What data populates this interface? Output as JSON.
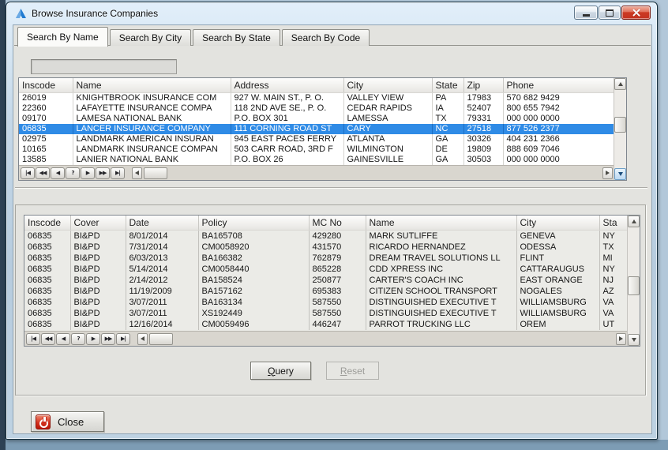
{
  "window": {
    "title": "Browse Insurance Companies"
  },
  "tabs": [
    {
      "label": "Search By Name",
      "active": true
    },
    {
      "label": "Search By City",
      "active": false
    },
    {
      "label": "Search By State",
      "active": false
    },
    {
      "label": "Search By Code",
      "active": false
    }
  ],
  "search_input": {
    "value": ""
  },
  "companies_grid": {
    "columns": [
      "Inscode",
      "Name",
      "Address",
      "City",
      "State",
      "Zip",
      "Phone"
    ],
    "selected_row": 3,
    "rows": [
      [
        "26019",
        "KNIGHTBROOK INSURANCE COM",
        "927 W. MAIN ST., P. O.",
        "VALLEY VIEW",
        "PA",
        "17983",
        "570 682 9429"
      ],
      [
        "22360",
        "LAFAYETTE INSURANCE COMPA",
        "118 2ND AVE SE., P. O.",
        "CEDAR RAPIDS",
        "IA",
        "52407",
        "800 655 7942"
      ],
      [
        "09170",
        "LAMESA NATIONAL BANK",
        "P.O. BOX 301",
        "LAMESSA",
        "TX",
        "79331",
        "000 000 0000"
      ],
      [
        "06835",
        "LANCER INSURANCE COMPANY",
        "111 CORNING ROAD ST",
        "CARY",
        "NC",
        "27518",
        "877 526 2377"
      ],
      [
        "02975",
        "LANDMARK AMERICAN INSURAN",
        "945 EAST PACES FERRY",
        "ATLANTA",
        "GA",
        "30326",
        "404 231 2366"
      ],
      [
        "10165",
        "LANDMARK INSURANCE COMPAN",
        "503 CARR ROAD, 3RD F",
        "WILMINGTON",
        "DE",
        "19809",
        "888 609 7046"
      ],
      [
        "13585",
        "LANIER NATIONAL BANK",
        "P.O. BOX 26",
        "GAINESVILLE",
        "GA",
        "30503",
        "000 000 0000"
      ]
    ]
  },
  "policies_grid": {
    "columns": [
      "Inscode",
      "Cover",
      "Date",
      "Policy",
      "MC No",
      "Name",
      "City",
      "Sta"
    ],
    "rows": [
      [
        "06835",
        "BI&PD",
        "8/01/2014",
        "BA165708",
        "429280",
        "MARK SUTLIFFE",
        "GENEVA",
        "NY"
      ],
      [
        "06835",
        "BI&PD",
        "7/31/2014",
        "CM0058920",
        "431570",
        "RICARDO HERNANDEZ",
        "ODESSA",
        "TX"
      ],
      [
        "06835",
        "BI&PD",
        "6/03/2013",
        "BA166382",
        "762879",
        "DREAM TRAVEL SOLUTIONS LL",
        "FLINT",
        "MI"
      ],
      [
        "06835",
        "BI&PD",
        "5/14/2014",
        "CM0058440",
        "865228",
        "CDD XPRESS INC",
        "CATTARAUGUS",
        "NY"
      ],
      [
        "06835",
        "BI&PD",
        "2/14/2012",
        "BA158524",
        "250877",
        "CARTER'S COACH INC",
        "EAST ORANGE",
        "NJ"
      ],
      [
        "06835",
        "BI&PD",
        "11/19/2009",
        "BA157162",
        "695383",
        "CITIZEN SCHOOL TRANSPORT",
        "NOGALES",
        "AZ"
      ],
      [
        "06835",
        "BI&PD",
        "3/07/2011",
        "BA163134",
        "587550",
        "DISTINGUISHED EXECUTIVE T",
        "WILLIAMSBURG",
        "VA"
      ],
      [
        "06835",
        "BI&PD",
        "3/07/2011",
        "XS192449",
        "587550",
        "DISTINGUISHED EXECUTIVE T",
        "WILLIAMSBURG",
        "VA"
      ],
      [
        "06835",
        "BI&PD",
        "12/16/2014",
        "CM0059496",
        "446247",
        "PARROT TRUCKING LLC",
        "OREM",
        "UT"
      ]
    ]
  },
  "record_nav": {
    "buttons": [
      {
        "name": "first",
        "glyph": "|◀"
      },
      {
        "name": "prior-page",
        "glyph": "◀◀"
      },
      {
        "name": "prior",
        "glyph": "◀"
      },
      {
        "name": "find",
        "glyph": "?"
      },
      {
        "name": "next",
        "glyph": "▶"
      },
      {
        "name": "next-page",
        "glyph": "▶▶"
      },
      {
        "name": "last",
        "glyph": "▶|"
      }
    ]
  },
  "actions": {
    "query": "Query",
    "reset": "Reset"
  },
  "footer": {
    "close": "Close"
  },
  "colors": {
    "selection": "#2f8be6",
    "titlebar_close": "#c43220",
    "power_icon_red": "#c11f14",
    "client_bg": "#e3e3df"
  }
}
